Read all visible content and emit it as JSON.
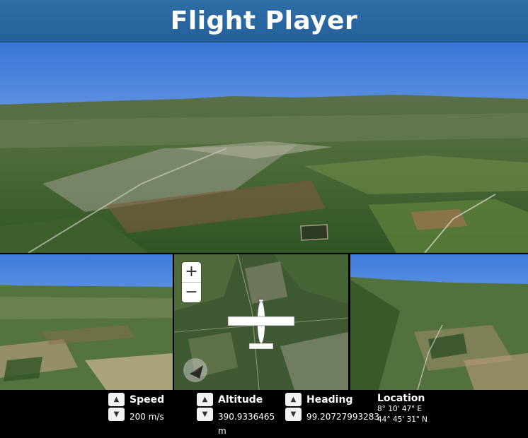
{
  "header": {
    "title": "Flight Player"
  },
  "map": {
    "zoom_in_label": "+",
    "zoom_out_label": "−"
  },
  "controls": {
    "speed": {
      "label": "Speed",
      "value": "200 m/s"
    },
    "altitude": {
      "label": "Altitude",
      "value": "390.9336465 m"
    },
    "heading": {
      "label": "Heading",
      "value": "99.20727993283"
    },
    "location": {
      "label": "Location",
      "longitude": "8° 10' 47\" E",
      "latitude": "44° 45' 31\" N"
    }
  },
  "icons": {
    "increment": "chevron-up-icon",
    "decrement": "chevron-down-icon",
    "aircraft": "airplane-icon",
    "compass": "compass-icon"
  }
}
